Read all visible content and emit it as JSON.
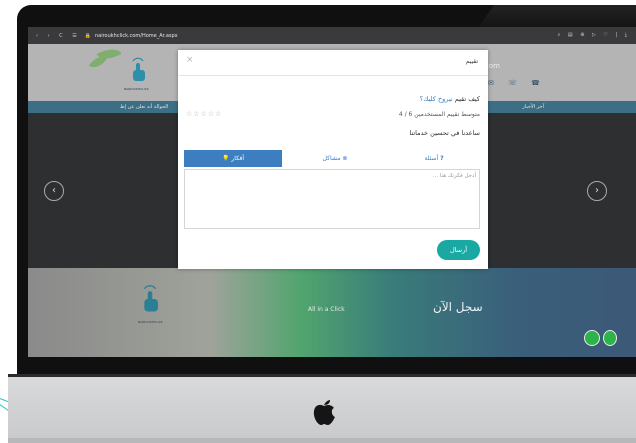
{
  "browser": {
    "url": "nairoukhclick.com/Home_Ar.aspx",
    "nav_glyphs": "‹ › C ☰"
  },
  "site": {
    "brand_small": "NAIROUKHCLICK",
    "contact_partial": "com",
    "news_label": "آخر الأخبار",
    "news_text": "الحوالة أنه نعلن عن إط",
    "footer_slogan": "All in a Click",
    "footer_register": "سجل الآن"
  },
  "modal": {
    "title": "تقييم",
    "close_glyph": "×",
    "question_prefix": "كيف تقيم",
    "question_link": "نيروخ كليك؟",
    "average_label": "متوسط تقييم المستخدمين 6 / 4",
    "stars": "☆☆☆☆☆",
    "help_text": "ساعدنا في تحسين خدماتنا",
    "tabs": [
      {
        "label": "أفكار",
        "icon": "lightbulb-icon",
        "active": true
      },
      {
        "label": "مشاكل",
        "icon": "x-circle-icon",
        "active": false
      },
      {
        "label": "أسئلة",
        "icon": "question-icon",
        "active": false
      }
    ],
    "textarea_placeholder": "أدخل فكرتك هنا ...",
    "send_label": "أرسال"
  },
  "colors": {
    "accent_blue": "#3d7ec0",
    "send_teal": "#19a8a2",
    "whatsapp_green": "#2cb34a"
  }
}
